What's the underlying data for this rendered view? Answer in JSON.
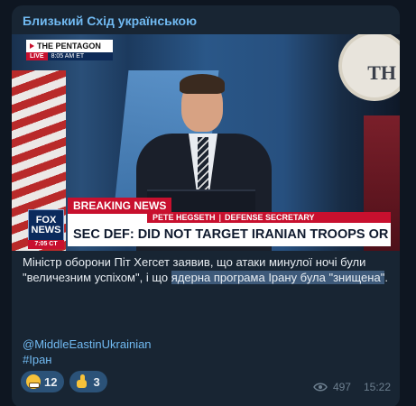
{
  "channel": {
    "name": "Близький Схід українською"
  },
  "video": {
    "bug_title": "THE PENTAGON",
    "bug_live": "LIVE",
    "bug_time": "8:05 AM ET",
    "seal_text": "TH",
    "fox_logo": "FOX NEWS",
    "fox_time": "7:05 CT",
    "breaking": "BREAKING NEWS",
    "name": "PETE HEGSETH",
    "title": "DEFENSE SECRETARY",
    "headline": "SEC DEF: DID NOT TARGET IRANIAN TROOPS OR PEOPLE"
  },
  "post": {
    "text_before": "Міністр оборони Піт Хегсет заявив, що атаки минулої ночі були \"величезним успіхом\", і що ",
    "text_highlight": "ядерна програма Ірану була \"знищена\"",
    "text_after": ".",
    "handle": "@MiddleEastinUkrainian",
    "hashtag": "#Іран"
  },
  "reactions": [
    {
      "icon": "grimace-emoji-icon",
      "count": "12"
    },
    {
      "icon": "thumbs-up-icon",
      "count": "3"
    }
  ],
  "meta": {
    "views": "497",
    "time": "15:22"
  },
  "colors": {
    "bg": "#0e1621",
    "bubble": "#182533",
    "accent": "#71baf2",
    "highlight": "#3e5a7a"
  }
}
